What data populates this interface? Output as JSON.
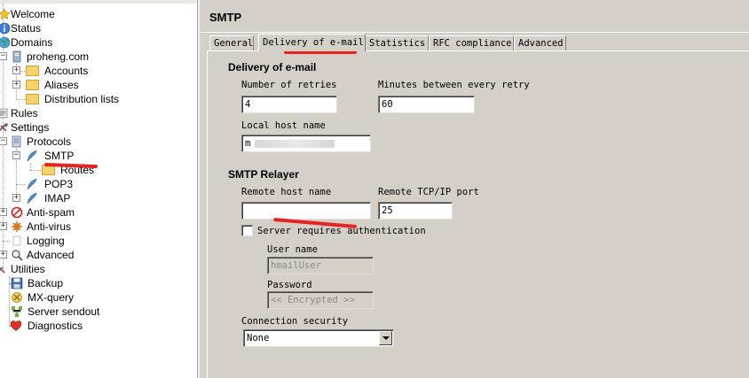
{
  "tree": {
    "items": [
      {
        "label": "Welcome",
        "icon": "star-icon"
      },
      {
        "label": "Status",
        "icon": "info-icon"
      },
      {
        "label": "Domains",
        "icon": "globe-icon"
      },
      {
        "label": "proheng.com",
        "icon": "server-icon"
      },
      {
        "label": "Accounts",
        "icon": "folder-icon"
      },
      {
        "label": "Aliases",
        "icon": "folder-icon"
      },
      {
        "label": "Distribution lists",
        "icon": "folder-icon"
      },
      {
        "label": "Rules",
        "icon": "rules-icon"
      },
      {
        "label": "Settings",
        "icon": "tools-icon"
      },
      {
        "label": "Protocols",
        "icon": "document-icon"
      },
      {
        "label": "SMTP",
        "icon": "feather-icon"
      },
      {
        "label": "Routes",
        "icon": "folder-icon"
      },
      {
        "label": "POP3",
        "icon": "feather-icon"
      },
      {
        "label": "IMAP",
        "icon": "feather-icon"
      },
      {
        "label": "Anti-spam",
        "icon": "anti-spam-icon"
      },
      {
        "label": "Anti-virus",
        "icon": "anti-virus-icon"
      },
      {
        "label": "Logging",
        "icon": "log-icon"
      },
      {
        "label": "Advanced",
        "icon": "magnifier-icon"
      },
      {
        "label": "Utilities",
        "icon": "tools-icon"
      },
      {
        "label": "Backup",
        "icon": "floppy-icon"
      },
      {
        "label": "MX-query",
        "icon": "mx-query-icon"
      },
      {
        "label": "Server sendout",
        "icon": "network-icon"
      },
      {
        "label": "Diagnostics",
        "icon": "heart-icon"
      }
    ]
  },
  "page": {
    "title": "SMTP"
  },
  "tabs": [
    "General",
    "Delivery of e-mail",
    "Statistics",
    "RFC compliance",
    "Advanced"
  ],
  "active_tab": "Delivery of e-mail",
  "delivery": {
    "section_title": "Delivery of e-mail",
    "retries_label": "Number of retries",
    "retries_value": "4",
    "minutes_label": "Minutes between every retry",
    "minutes_value": "60",
    "local_host_label": "Local host name",
    "local_host_value": "m"
  },
  "relayer": {
    "section_title": "SMTP Relayer",
    "remote_host_label": "Remote host name",
    "remote_host_value": "",
    "remote_port_label": "Remote TCP/IP port",
    "remote_port_value": "25",
    "auth_label": "Server requires authentication",
    "auth_checked": false,
    "username_label": "User name",
    "username_value": "hmailUser",
    "password_label": "Password",
    "password_value": "<< Encrypted >>",
    "security_label": "Connection security",
    "security_value": "None"
  },
  "colors": {
    "panel": "#d4d0c8",
    "annotation": "#e8221e"
  }
}
